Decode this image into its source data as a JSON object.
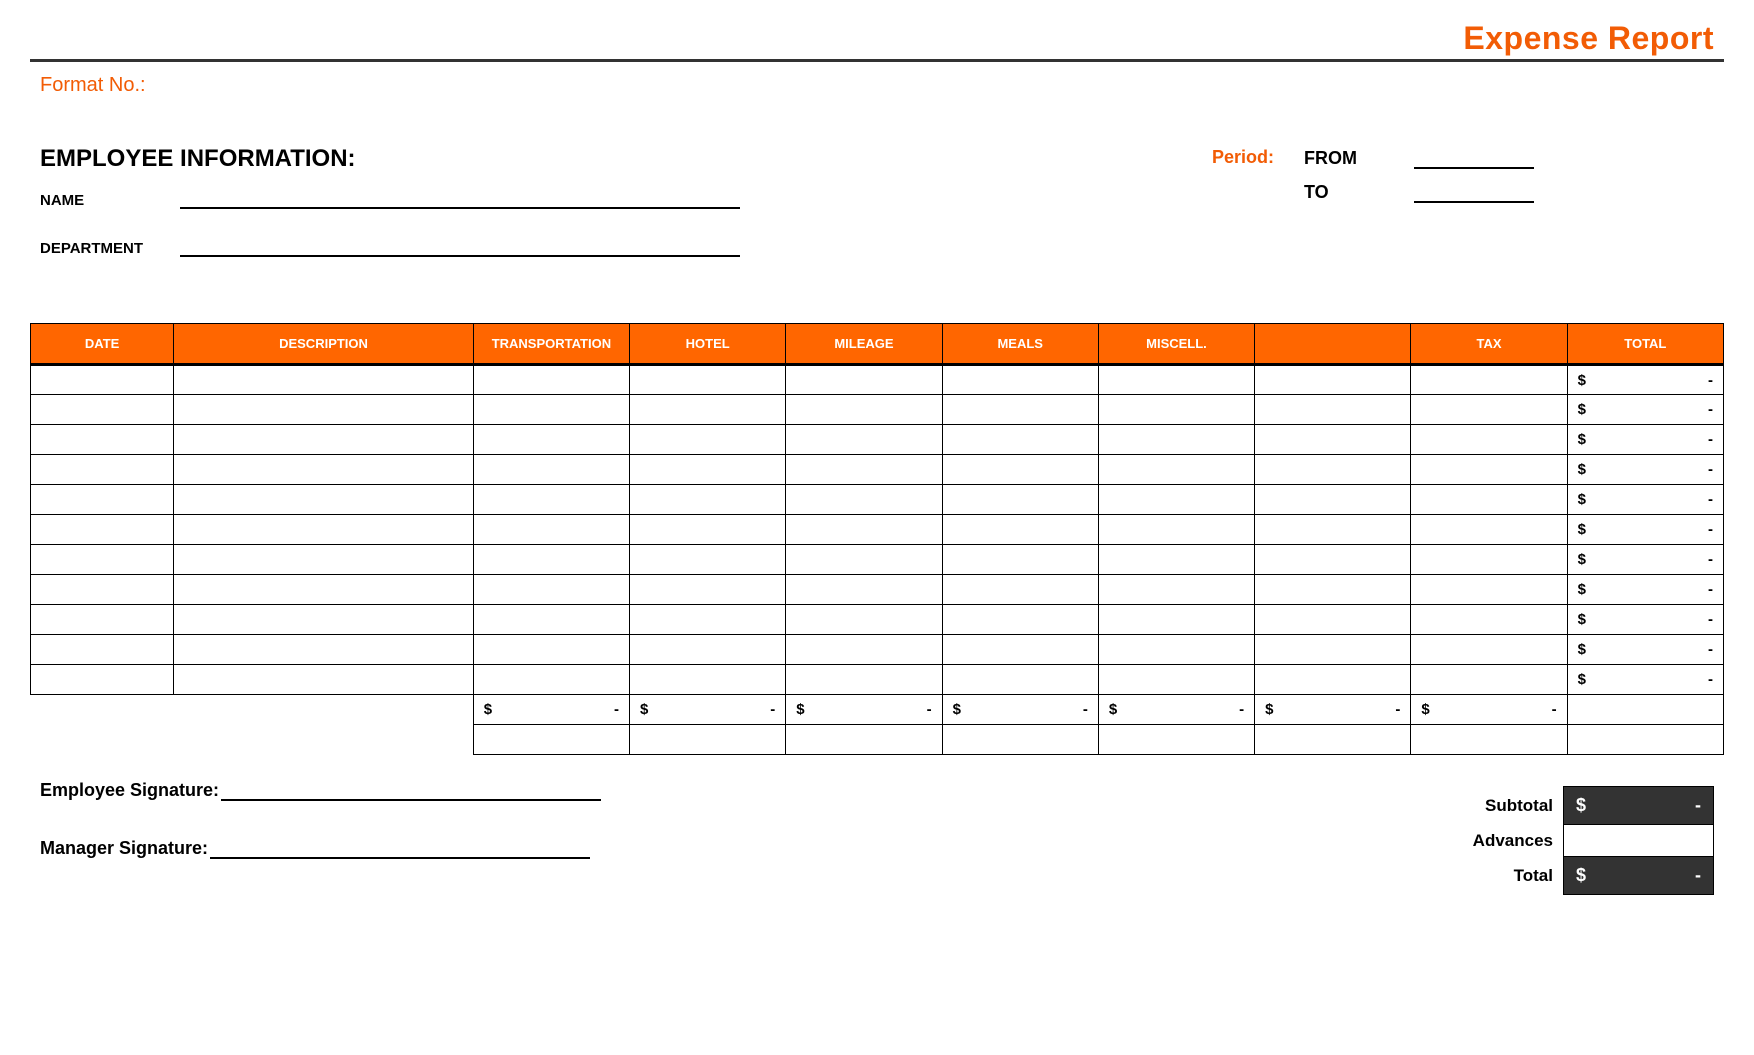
{
  "header": {
    "title": "Expense Report",
    "format_no_label": "Format No.:"
  },
  "employee": {
    "section_label": "EMPLOYEE INFORMATION:",
    "name_label": "NAME",
    "department_label": "DEPARTMENT"
  },
  "period": {
    "label": "Period:",
    "from_label": "FROM",
    "to_label": "TO"
  },
  "table": {
    "headers": [
      "DATE",
      "DESCRIPTION",
      "TRANSPORTATION",
      "HOTEL",
      "MILEAGE",
      "MEALS",
      "MISCELL.",
      "",
      "TAX",
      "TOTAL"
    ],
    "row_count": 11,
    "currency": "$",
    "dash": "-",
    "column_subtotals": [
      "$",
      "$",
      "$",
      "$",
      "$",
      "$",
      "$"
    ]
  },
  "summary": {
    "subtotal_label": "Subtotal",
    "advances_label": "Advances",
    "total_label": "Total",
    "subtotal_value": "-",
    "advances_value": "",
    "total_value": "-",
    "currency": "$"
  },
  "signatures": {
    "employee_label": "Employee Signature:",
    "manager_label": "Manager Signature:"
  }
}
